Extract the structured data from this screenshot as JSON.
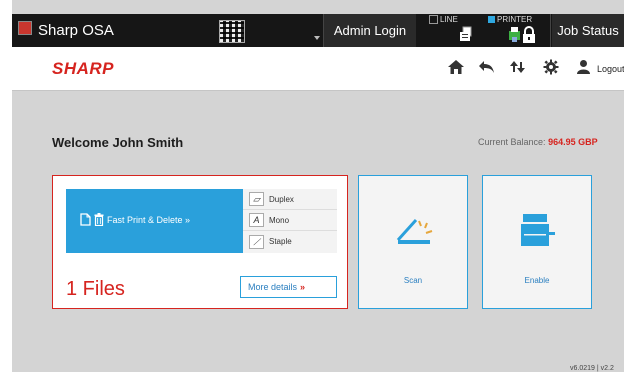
{
  "topbar": {
    "title": "Sharp OSA",
    "admin_login": "Admin Login",
    "line_label": "LINE",
    "printer_label": "PRINTER",
    "job_status": "Job Status"
  },
  "header": {
    "brand": "SHARP",
    "logout": "Logout"
  },
  "main": {
    "welcome": "Welcome John Smith",
    "balance_label": "Current Balance:",
    "balance_value": "964.95 GBP"
  },
  "print_card": {
    "fast_print": "Fast Print & Delete »",
    "options": [
      {
        "label": "Duplex",
        "icon": "duplex-icon"
      },
      {
        "label": "Mono",
        "icon": "mono-icon"
      },
      {
        "label": "Staple",
        "icon": "staple-icon"
      }
    ],
    "files": "1 Files",
    "more_details": "More details",
    "more_arrow": "»"
  },
  "tiles": {
    "scan": "Scan",
    "enable": "Enable"
  },
  "footer": {
    "version": "v6.0219 | v2.2"
  },
  "colors": {
    "brand_red": "#d6241f",
    "accent_blue": "#2aa0db"
  }
}
